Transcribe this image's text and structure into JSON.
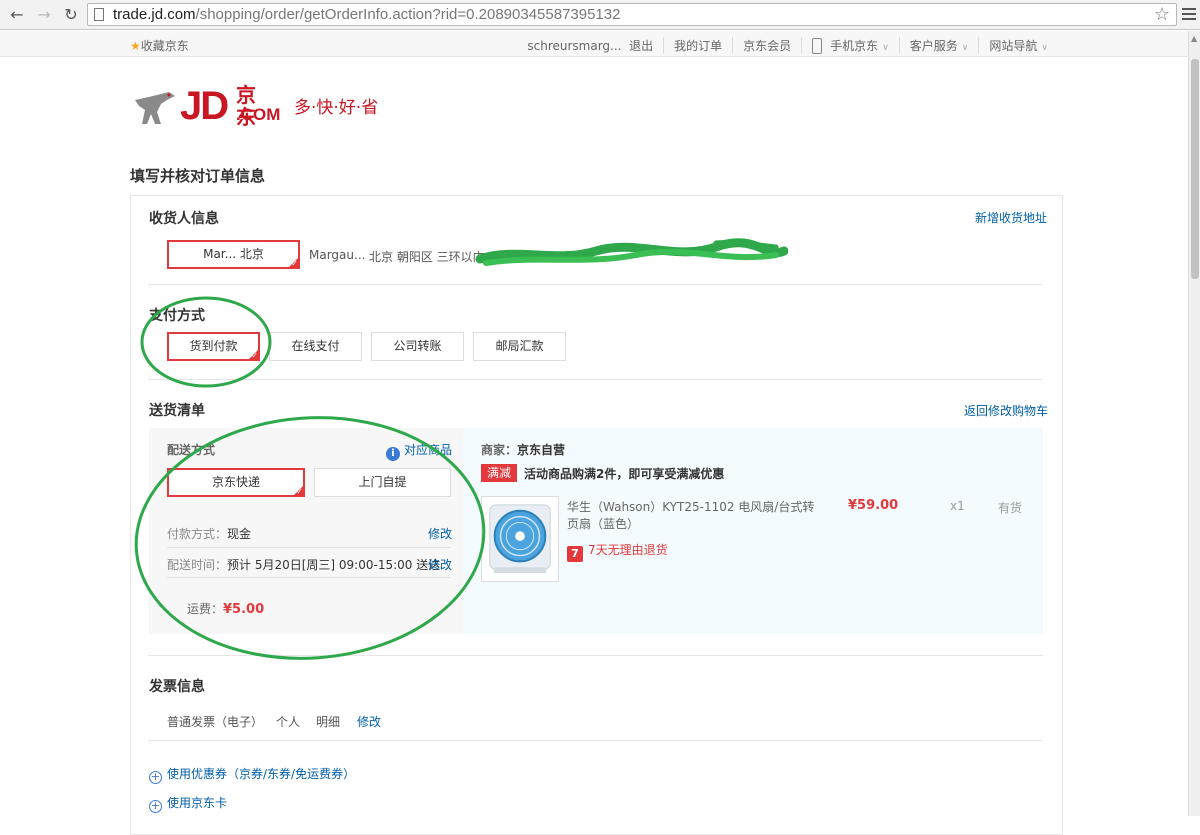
{
  "browser": {
    "url_host": "trade.jd.com",
    "url_path": "/shopping/order/getOrderInfo.action?rid=0.20890345587395132"
  },
  "topbar": {
    "favorite": "收藏京东",
    "username": "schreursmarg...",
    "logout": "退出",
    "my_orders": "我的订单",
    "jd_member": "京东会员",
    "mobile_jd": "手机京东",
    "customer_service": "客户服务",
    "site_nav": "网站导航"
  },
  "logo": {
    "jd": "JD",
    "cn": "京东",
    "com": ".COM",
    "slogan": "多·快·好·省"
  },
  "page_title": "填写并核对订单信息",
  "consignee": {
    "title": "收货人信息",
    "add_address": "新增收货地址",
    "selected": "Mar... 北京",
    "name": "Margau...",
    "address": "北京 朝阳区 三环以内"
  },
  "payment": {
    "title": "支付方式",
    "options": [
      "货到付款",
      "在线支付",
      "公司转账",
      "邮局汇款"
    ]
  },
  "shipping": {
    "title": "送货清单",
    "back_to_cart": "返回修改购物车",
    "method_label": "配送方式",
    "target_goods": "对应商品",
    "methods": [
      "京东快递",
      "上门自提"
    ],
    "pay_way_label": "付款方式：",
    "pay_way_value": "现金",
    "edit": "修改",
    "time_label": "配送时间：",
    "time_value": "预计 5月20日[周三] 09:00-15:00 送达",
    "fee_label": "运费：",
    "fee_value": "¥5.00"
  },
  "seller": {
    "label": "商家：",
    "name": "京东自营",
    "promo_badge": "满减",
    "promo_text": "活动商品购满2件，即可享受满减优惠"
  },
  "product": {
    "name_line1": "华生（Wahson）KYT25-1102 电风扇/台式转",
    "name_line2": "页扇（蓝色）",
    "price": "¥59.00",
    "qty": "x1",
    "stock": "有货",
    "refund": "7天无理由退货",
    "refund_icon_char": "7"
  },
  "invoice": {
    "title": "发票信息",
    "type": "普通发票（电子）",
    "holder": "个人",
    "content": "明细",
    "edit": "修改"
  },
  "extras": {
    "coupons": "使用优惠券（京券/东券/免运费券）",
    "jd_card": "使用京东卡"
  }
}
